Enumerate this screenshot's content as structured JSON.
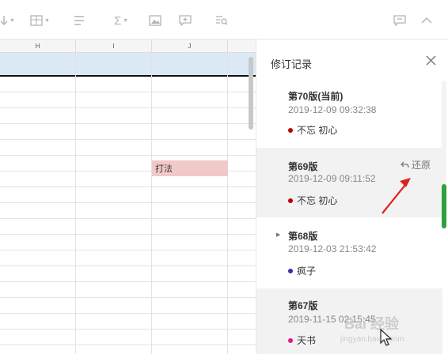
{
  "toolbar": {
    "icons": [
      "sort-icon",
      "image-dropdown-icon",
      "format-icon",
      "sum-icon",
      "picture-icon",
      "comment-icon",
      "find-icon",
      "chat-icon",
      "collapse-icon"
    ]
  },
  "grid": {
    "columns": [
      "H",
      "I",
      "J"
    ],
    "cell_text": "打法",
    "cell_color": "#f2c9c9",
    "selection_color": "#dbe8f5"
  },
  "panel": {
    "title": "修订记录",
    "restore_label": "还原",
    "versions": [
      {
        "title": "第70版(当前)",
        "time": "2019-12-09 09:32:38",
        "user": "不忘 初心",
        "dot_color": "#c00000"
      },
      {
        "title": "第69版",
        "time": "2019-12-09 09:11:52",
        "user": "不忘 初心",
        "dot_color": "#c00000"
      },
      {
        "title": "第68版",
        "time": "2019-12-03 21:53:42",
        "user": "疯子",
        "dot_color": "#3333aa"
      },
      {
        "title": "第67版",
        "time": "2019-11-15 02:15:45",
        "user": "天书",
        "dot_color": "#e0198c"
      }
    ]
  },
  "watermark": {
    "text": "Bai 经验",
    "sub": "jingyan.baidu.com"
  },
  "accent": {
    "arrow": "#e02020",
    "scroll": "#2fa040"
  }
}
